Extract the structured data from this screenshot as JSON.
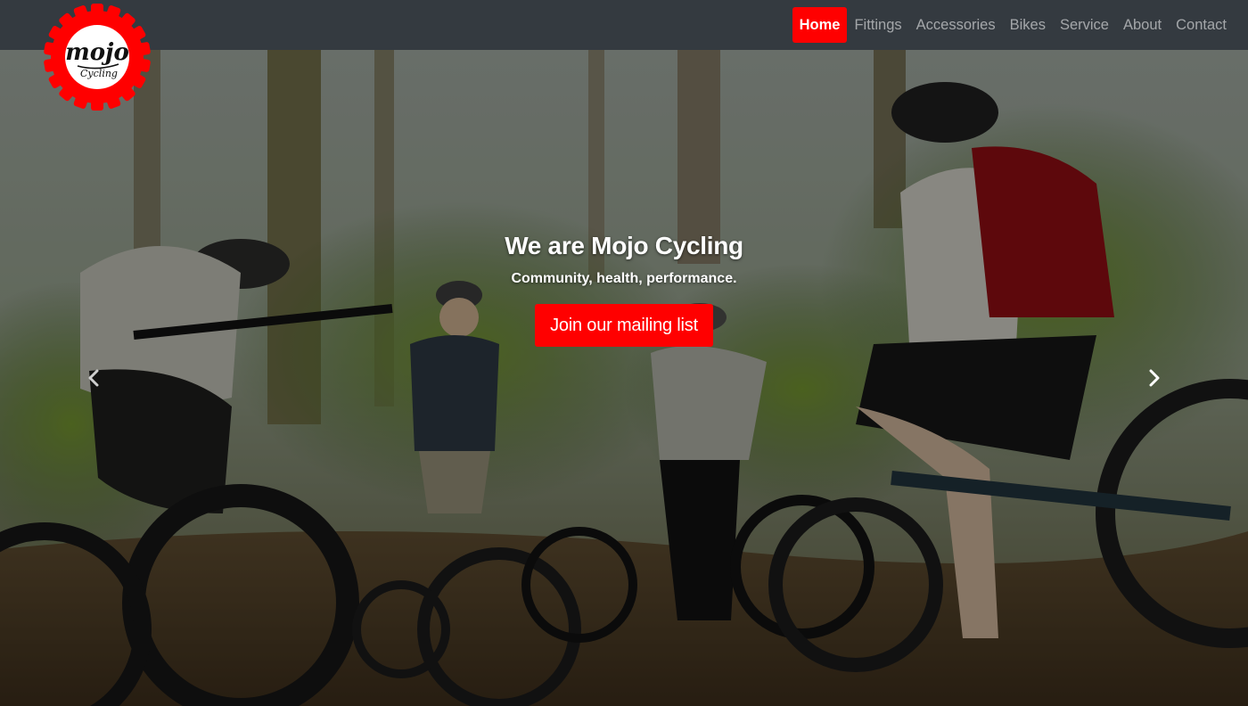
{
  "brand": {
    "logo_text": "mojo",
    "logo_subtext": "Cycling",
    "accent_color": "#ff0000",
    "navbar_color": "#343a40"
  },
  "nav": {
    "items": [
      {
        "label": "Home",
        "active": true
      },
      {
        "label": "Fittings",
        "active": false
      },
      {
        "label": "Accessories",
        "active": false
      },
      {
        "label": "Bikes",
        "active": false
      },
      {
        "label": "Service",
        "active": false
      },
      {
        "label": "About",
        "active": false
      },
      {
        "label": "Contact",
        "active": false
      }
    ]
  },
  "hero": {
    "title": "We are Mojo Cycling",
    "subtitle": "Community, health, performance.",
    "cta_label": "Join our mailing list",
    "prev_icon": "chevron-left-icon",
    "next_icon": "chevron-right-icon"
  }
}
